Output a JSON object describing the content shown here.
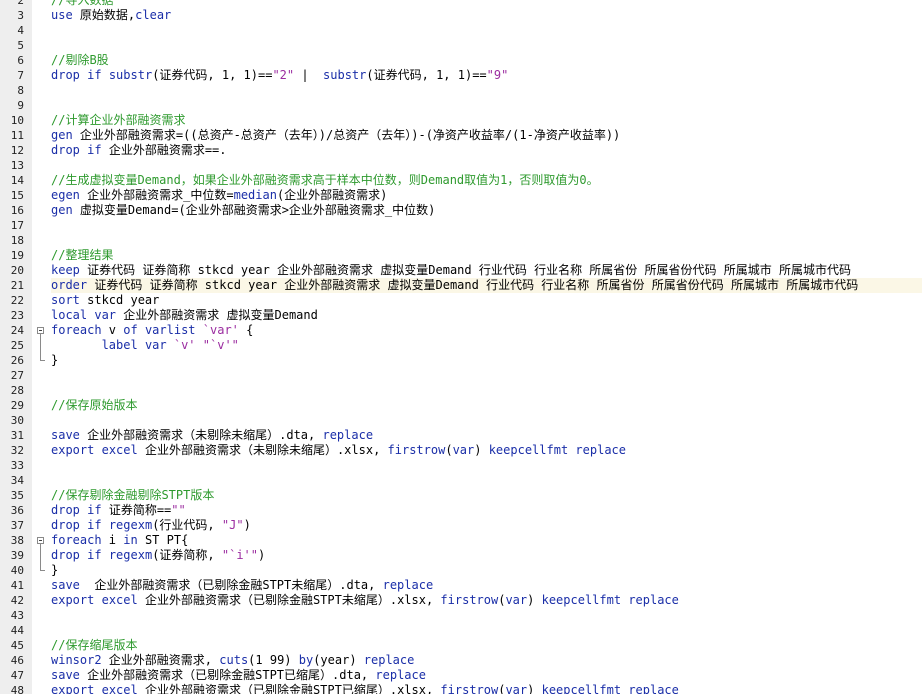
{
  "editor": {
    "lines": [
      {
        "n": "2",
        "t": [
          [
            "cm",
            "//导入数据"
          ]
        ]
      },
      {
        "n": "3",
        "t": [
          [
            "kw",
            "use"
          ],
          [
            "tx",
            " 原始数据,"
          ],
          [
            "kw",
            "clear"
          ]
        ]
      },
      {
        "n": "4",
        "t": []
      },
      {
        "n": "5",
        "t": []
      },
      {
        "n": "6",
        "t": [
          [
            "cm",
            "//剔除B股"
          ]
        ]
      },
      {
        "n": "7",
        "t": [
          [
            "kw",
            "drop"
          ],
          [
            "tx",
            " "
          ],
          [
            "kw",
            "if"
          ],
          [
            "tx",
            " "
          ],
          [
            "kw",
            "substr"
          ],
          [
            "tx",
            "(证券代码, 1, 1)=="
          ],
          [
            "st",
            "\"2\""
          ],
          [
            "tx",
            " |  "
          ],
          [
            "kw",
            "substr"
          ],
          [
            "tx",
            "(证券代码, 1, 1)=="
          ],
          [
            "st",
            "\"9\""
          ]
        ]
      },
      {
        "n": "8",
        "t": []
      },
      {
        "n": "9",
        "t": []
      },
      {
        "n": "10",
        "t": [
          [
            "cm",
            "//计算企业外部融资需求"
          ]
        ]
      },
      {
        "n": "11",
        "t": [
          [
            "kw",
            "gen"
          ],
          [
            "tx",
            " 企业外部融资需求=((总资产-总资产（去年）)/总资产（去年）)-(净资产收益率/(1-净资产收益率))"
          ]
        ]
      },
      {
        "n": "12",
        "t": [
          [
            "kw",
            "drop"
          ],
          [
            "tx",
            " "
          ],
          [
            "kw",
            "if"
          ],
          [
            "tx",
            " 企业外部融资需求==."
          ]
        ]
      },
      {
        "n": "13",
        "t": []
      },
      {
        "n": "14",
        "t": [
          [
            "cm",
            "//生成虚拟变量Demand，如果企业外部融资需求高于样本中位数，则Demand取值为1，否则取值为0。"
          ]
        ]
      },
      {
        "n": "15",
        "t": [
          [
            "kw",
            "egen"
          ],
          [
            "tx",
            " 企业外部融资需求_中位数="
          ],
          [
            "kw",
            "median"
          ],
          [
            "tx",
            "(企业外部融资需求)"
          ]
        ]
      },
      {
        "n": "16",
        "t": [
          [
            "kw",
            "gen"
          ],
          [
            "tx",
            " 虚拟变量Demand=(企业外部融资需求>企业外部融资需求_中位数)"
          ]
        ]
      },
      {
        "n": "17",
        "t": []
      },
      {
        "n": "18",
        "t": []
      },
      {
        "n": "19",
        "t": [
          [
            "cm",
            "//整理结果"
          ]
        ]
      },
      {
        "n": "20",
        "t": [
          [
            "kw",
            "keep"
          ],
          [
            "tx",
            " 证券代码 证券简称 stkcd year 企业外部融资需求 虚拟变量Demand 行业代码 行业名称 所属省份 所属省份代码 所属城市 所属城市代码"
          ]
        ]
      },
      {
        "n": "21",
        "hl": true,
        "t": [
          [
            "kw",
            "order"
          ],
          [
            "tx",
            " 证券代码 证券简称 stkcd year 企业外部融资需求 虚拟变量Demand 行业代码 行业名称 所属省份 所属省份代码 所属城市 所属城市代码"
          ]
        ]
      },
      {
        "n": "22",
        "t": [
          [
            "kw",
            "sort"
          ],
          [
            "tx",
            " stkcd year"
          ]
        ]
      },
      {
        "n": "23",
        "t": [
          [
            "kw",
            "local"
          ],
          [
            "tx",
            " "
          ],
          [
            "kw",
            "var"
          ],
          [
            "tx",
            " 企业外部融资需求 虚拟变量Demand"
          ]
        ]
      },
      {
        "n": "24",
        "t": [
          [
            "kw",
            "foreach"
          ],
          [
            "tx",
            " v "
          ],
          [
            "kw",
            "of"
          ],
          [
            "tx",
            " "
          ],
          [
            "kw",
            "varlist"
          ],
          [
            "tx",
            " "
          ],
          [
            "st",
            "`var'"
          ],
          [
            "tx",
            " {"
          ]
        ]
      },
      {
        "n": "25",
        "t": [
          [
            "tx",
            "       "
          ],
          [
            "kw",
            "label"
          ],
          [
            "tx",
            " "
          ],
          [
            "kw",
            "var"
          ],
          [
            "tx",
            " "
          ],
          [
            "st",
            "`v'"
          ],
          [
            "tx",
            " "
          ],
          [
            "st",
            "\"`v'\""
          ]
        ]
      },
      {
        "n": "26",
        "t": [
          [
            "tx",
            "}"
          ]
        ]
      },
      {
        "n": "27",
        "t": []
      },
      {
        "n": "28",
        "t": []
      },
      {
        "n": "29",
        "t": [
          [
            "cm",
            "//保存原始版本"
          ]
        ]
      },
      {
        "n": "30",
        "t": []
      },
      {
        "n": "31",
        "t": [
          [
            "kw",
            "save"
          ],
          [
            "tx",
            " 企业外部融资需求（未剔除未缩尾）.dta, "
          ],
          [
            "kw",
            "replace"
          ]
        ]
      },
      {
        "n": "32",
        "t": [
          [
            "kw",
            "export"
          ],
          [
            "tx",
            " "
          ],
          [
            "kw",
            "excel"
          ],
          [
            "tx",
            " 企业外部融资需求（未剔除未缩尾）.xlsx, "
          ],
          [
            "kw",
            "firstrow"
          ],
          [
            "tx",
            "("
          ],
          [
            "kw",
            "var"
          ],
          [
            "tx",
            ") "
          ],
          [
            "kw",
            "keepcellfmt"
          ],
          [
            "tx",
            " "
          ],
          [
            "kw",
            "replace"
          ]
        ]
      },
      {
        "n": "33",
        "t": []
      },
      {
        "n": "34",
        "t": []
      },
      {
        "n": "35",
        "t": [
          [
            "cm",
            "//保存剔除金融剔除STPT版本"
          ]
        ]
      },
      {
        "n": "36",
        "t": [
          [
            "kw",
            "drop"
          ],
          [
            "tx",
            " "
          ],
          [
            "kw",
            "if"
          ],
          [
            "tx",
            " 证券简称=="
          ],
          [
            "st",
            "\"\""
          ]
        ]
      },
      {
        "n": "37",
        "t": [
          [
            "kw",
            "drop"
          ],
          [
            "tx",
            " "
          ],
          [
            "kw",
            "if"
          ],
          [
            "tx",
            " "
          ],
          [
            "kw",
            "regexm"
          ],
          [
            "tx",
            "(行业代码, "
          ],
          [
            "st",
            "\"J\""
          ],
          [
            "tx",
            ")"
          ]
        ]
      },
      {
        "n": "38",
        "t": [
          [
            "kw",
            "foreach"
          ],
          [
            "tx",
            " i "
          ],
          [
            "kw",
            "in"
          ],
          [
            "tx",
            " ST PT{"
          ]
        ]
      },
      {
        "n": "39",
        "t": [
          [
            "kw",
            "drop"
          ],
          [
            "tx",
            " "
          ],
          [
            "kw",
            "if"
          ],
          [
            "tx",
            " "
          ],
          [
            "kw",
            "regexm"
          ],
          [
            "tx",
            "(证券简称, "
          ],
          [
            "st",
            "\"`i'\""
          ],
          [
            "tx",
            ")"
          ]
        ]
      },
      {
        "n": "40",
        "t": [
          [
            "tx",
            "}"
          ]
        ]
      },
      {
        "n": "41",
        "t": [
          [
            "kw",
            "save"
          ],
          [
            "tx",
            "  企业外部融资需求（已剔除金融STPT未缩尾）.dta, "
          ],
          [
            "kw",
            "replace"
          ]
        ]
      },
      {
        "n": "42",
        "t": [
          [
            "kw",
            "export"
          ],
          [
            "tx",
            " "
          ],
          [
            "kw",
            "excel"
          ],
          [
            "tx",
            " 企业外部融资需求（已剔除金融STPT未缩尾）.xlsx, "
          ],
          [
            "kw",
            "firstrow"
          ],
          [
            "tx",
            "("
          ],
          [
            "kw",
            "var"
          ],
          [
            "tx",
            ") "
          ],
          [
            "kw",
            "keepcellfmt"
          ],
          [
            "tx",
            " "
          ],
          [
            "kw",
            "replace"
          ]
        ]
      },
      {
        "n": "43",
        "t": []
      },
      {
        "n": "44",
        "t": []
      },
      {
        "n": "45",
        "t": [
          [
            "cm",
            "//保存缩尾版本"
          ]
        ]
      },
      {
        "n": "46",
        "t": [
          [
            "kw",
            "winsor2"
          ],
          [
            "tx",
            " 企业外部融资需求, "
          ],
          [
            "kw",
            "cuts"
          ],
          [
            "tx",
            "(1 99) "
          ],
          [
            "kw",
            "by"
          ],
          [
            "tx",
            "(year) "
          ],
          [
            "kw",
            "replace"
          ]
        ]
      },
      {
        "n": "47",
        "t": [
          [
            "kw",
            "save"
          ],
          [
            "tx",
            " 企业外部融资需求（已剔除金融STPT已缩尾）.dta, "
          ],
          [
            "kw",
            "replace"
          ]
        ]
      },
      {
        "n": "48",
        "t": [
          [
            "kw",
            "export"
          ],
          [
            "tx",
            " "
          ],
          [
            "kw",
            "excel"
          ],
          [
            "tx",
            " 企业外部融资需求（已剔除金融STPT已缩尾）.xlsx, "
          ],
          [
            "kw",
            "firstrow"
          ],
          [
            "tx",
            "("
          ],
          [
            "kw",
            "var"
          ],
          [
            "tx",
            ") "
          ],
          [
            "kw",
            "keepcellfmt"
          ],
          [
            "tx",
            " "
          ],
          [
            "kw",
            "replace"
          ]
        ]
      }
    ],
    "colors": {
      "keyword": "#1a2ea8",
      "comment": "#2e9a2e",
      "string": "#9b2ca0",
      "text": "#000000",
      "current_line": "#fbf7e6"
    },
    "fold_markers": [
      {
        "start_line": "24",
        "end_line": "26",
        "icon": "fold-collapse-icon"
      },
      {
        "start_line": "38",
        "end_line": "40",
        "icon": "fold-collapse-icon"
      }
    ]
  }
}
